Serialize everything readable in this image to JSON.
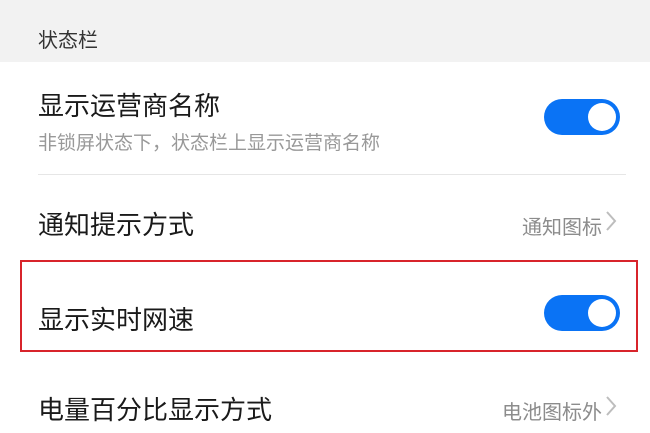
{
  "section": {
    "title": "状态栏"
  },
  "rows": [
    {
      "title": "显示运营商名称",
      "subtitle": "非锁屏状态下，状态栏上显示运营商名称",
      "toggle_on": true
    },
    {
      "title": "通知提示方式",
      "value": "通知图标"
    },
    {
      "title": "显示实时网速",
      "toggle_on": true
    },
    {
      "title": "电量百分比显示方式",
      "value": "电池图标外"
    }
  ],
  "colors": {
    "toggle": "#0a73f5",
    "highlight": "#d8242b",
    "header_bg": "#f2f2f2"
  },
  "icons": {
    "chevron": "chevron-right-icon"
  }
}
